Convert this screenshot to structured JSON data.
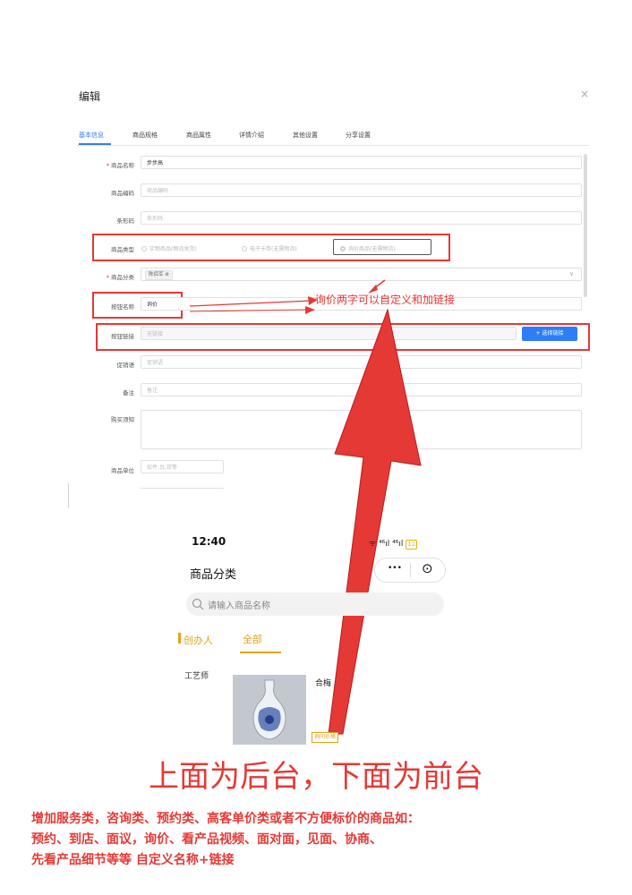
{
  "dialog": {
    "title": "编辑",
    "close": "×",
    "tabs": [
      "基本信息",
      "商品规格",
      "商品属性",
      "详情介绍",
      "其他设置",
      "分享设置"
    ],
    "fields": {
      "name_label": "商品名称",
      "name_value": "步步高",
      "code_label": "商品编码",
      "code_placeholder": "商品编码",
      "barcode_label": "条形码",
      "barcode_placeholder": "条形码",
      "type_label": "商品类型",
      "type_options": [
        "实物商品(物流发货)",
        "电子卡券(无需物流)",
        "询价商品(无需物流)"
      ],
      "category_label": "商品分类",
      "category_tag": "陈佰军",
      "category_tag_close": "⊗",
      "category_arrow": "∨",
      "button_name_label": "按钮名称",
      "button_name_value": "询价",
      "button_link_label": "按钮链接",
      "button_link_placeholder": "无链接",
      "select_link_button": "+ 选择链接",
      "promo_label": "促销语",
      "promo_placeholder": "促销语",
      "remark_label": "备注",
      "remark_placeholder": "备注",
      "notice_label": "购买须知",
      "unit_label": "商品单位",
      "unit_placeholder": "如件,台,双等"
    },
    "required_mark": "*"
  },
  "annotation": "询价两字可以自定义和加链接",
  "mobile": {
    "time": "12:40",
    "status": "ᯤ ⁴⁶ıl ⁴⁶ıl",
    "battery": "11",
    "title": "商品分类",
    "capsule_dots": "•••",
    "capsule_target": "⊙",
    "search_placeholder": "请输入商品名称",
    "categories": [
      "创办人",
      "全部"
    ],
    "side_item": "工艺师",
    "product_name": "合梅",
    "inquiry_button": "询问价格"
  },
  "caption": "上面为后台，下面为前台",
  "notes": [
    "增加服务类，咨询类、预约类、高客单价类或者不方便标价的商品如：",
    "预约、到店、面议，询价、看产品视频、面对面，见面、协商、",
    "先看产品细节等等 自定义名称+链接"
  ],
  "colors": {
    "accent_blue": "#2f7df6",
    "annotation_red": "#e53935",
    "mini_program_gold": "#e5a21b"
  }
}
